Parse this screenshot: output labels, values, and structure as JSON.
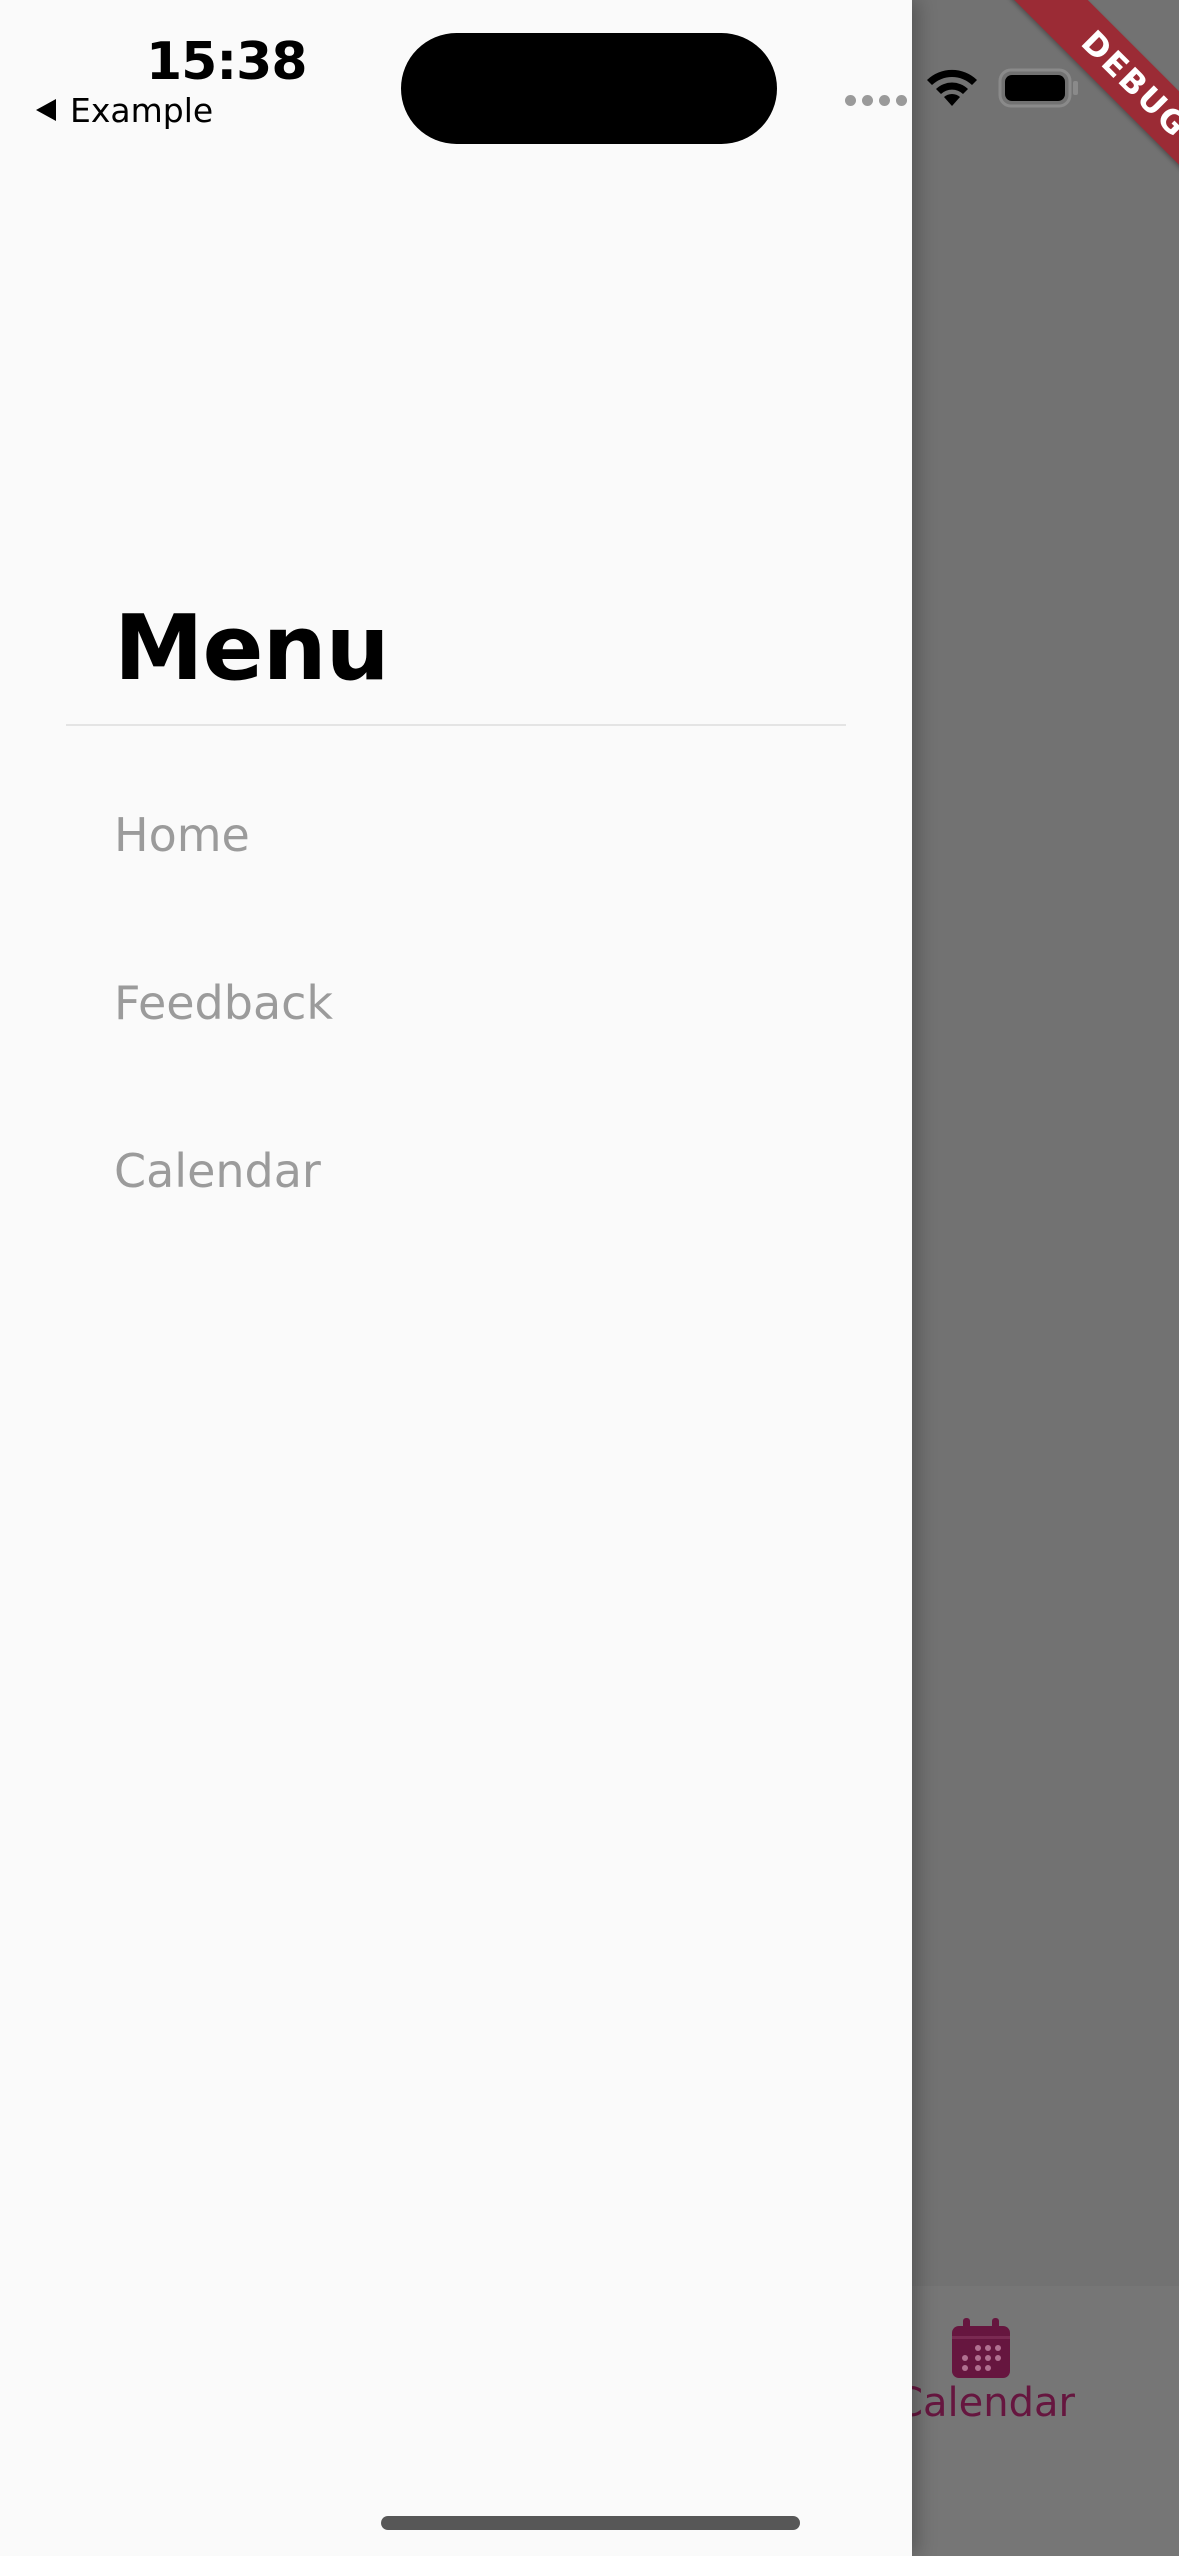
{
  "status_bar": {
    "time": "15:38",
    "back_app": "Example"
  },
  "drawer": {
    "title": "Menu",
    "items": [
      {
        "label": "Home"
      },
      {
        "label": "Feedback"
      },
      {
        "label": "Calendar"
      }
    ]
  },
  "background_app": {
    "bottom_tab_label": "Calendar",
    "bottom_tab_icon": "calendar-icon",
    "accent_color": "#66163f"
  },
  "debug_banner": {
    "label": "DEBUG",
    "color": "#9b2b35"
  }
}
